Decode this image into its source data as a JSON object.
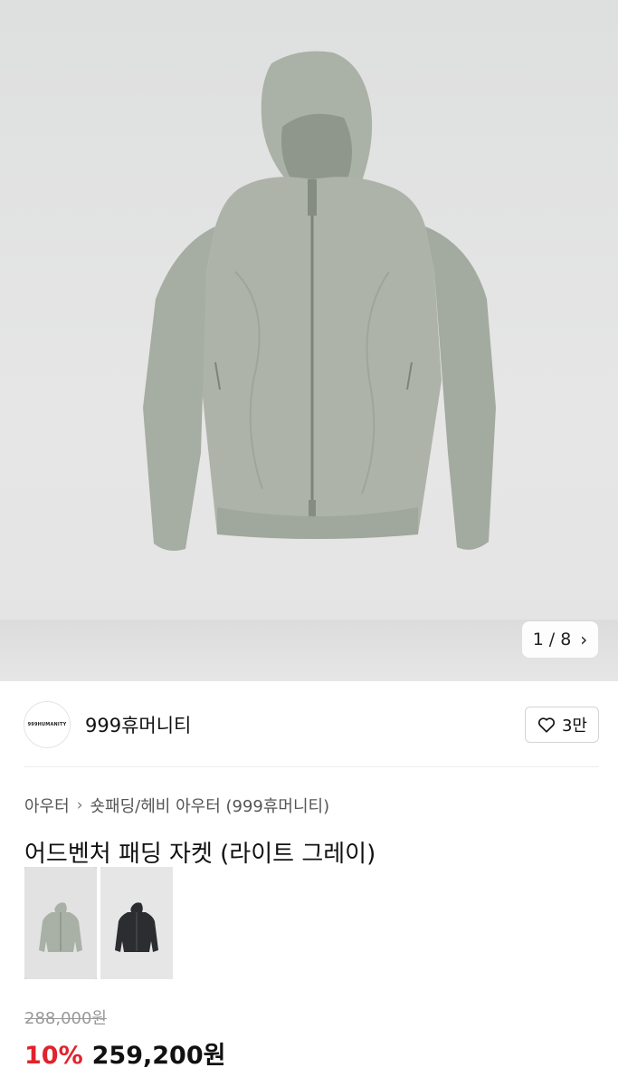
{
  "gallery": {
    "current_page": "1",
    "separator": "/",
    "total_pages": "8",
    "next_icon": "chevron-right-icon",
    "image": "gray-hooded-jacket"
  },
  "brand": {
    "logo_text": "999HUMANITY",
    "name": "999휴머니티",
    "like_icon": "heart-outline-icon",
    "like_count": "3만"
  },
  "breadcrumb": {
    "items": [
      "아우터",
      "숏패딩/헤비 아우터 (999휴머니티)"
    ],
    "separator_icon": "chevron-right-icon"
  },
  "product": {
    "title": "어드벤처 패딩 자켓 (라이트 그레이)",
    "color_options": [
      {
        "name": "light-gray-jacket-thumbnail",
        "selected": true,
        "color": "#a9b0a6"
      },
      {
        "name": "black-jacket-thumbnail",
        "selected": false,
        "color": "#2b2d30"
      }
    ],
    "original_price": "288,000원",
    "discount": "10%",
    "sale_price": "259,200원"
  },
  "colors": {
    "discount_red": "#e0232d",
    "jacket_gray": "#a9b0a6",
    "background_gray": "#e3e3e3"
  }
}
